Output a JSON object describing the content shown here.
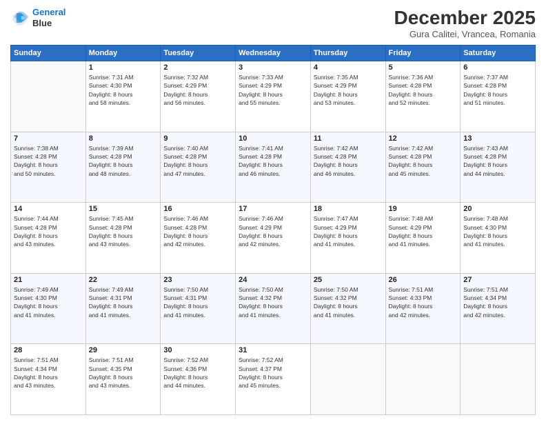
{
  "header": {
    "logo_line1": "General",
    "logo_line2": "Blue",
    "month": "December 2025",
    "location": "Gura Calitei, Vrancea, Romania"
  },
  "weekdays": [
    "Sunday",
    "Monday",
    "Tuesday",
    "Wednesday",
    "Thursday",
    "Friday",
    "Saturday"
  ],
  "weeks": [
    [
      {
        "day": "",
        "info": ""
      },
      {
        "day": "1",
        "info": "Sunrise: 7:31 AM\nSunset: 4:30 PM\nDaylight: 8 hours\nand 58 minutes."
      },
      {
        "day": "2",
        "info": "Sunrise: 7:32 AM\nSunset: 4:29 PM\nDaylight: 8 hours\nand 56 minutes."
      },
      {
        "day": "3",
        "info": "Sunrise: 7:33 AM\nSunset: 4:29 PM\nDaylight: 8 hours\nand 55 minutes."
      },
      {
        "day": "4",
        "info": "Sunrise: 7:35 AM\nSunset: 4:29 PM\nDaylight: 8 hours\nand 53 minutes."
      },
      {
        "day": "5",
        "info": "Sunrise: 7:36 AM\nSunset: 4:28 PM\nDaylight: 8 hours\nand 52 minutes."
      },
      {
        "day": "6",
        "info": "Sunrise: 7:37 AM\nSunset: 4:28 PM\nDaylight: 8 hours\nand 51 minutes."
      }
    ],
    [
      {
        "day": "7",
        "info": "Sunrise: 7:38 AM\nSunset: 4:28 PM\nDaylight: 8 hours\nand 50 minutes."
      },
      {
        "day": "8",
        "info": "Sunrise: 7:39 AM\nSunset: 4:28 PM\nDaylight: 8 hours\nand 48 minutes."
      },
      {
        "day": "9",
        "info": "Sunrise: 7:40 AM\nSunset: 4:28 PM\nDaylight: 8 hours\nand 47 minutes."
      },
      {
        "day": "10",
        "info": "Sunrise: 7:41 AM\nSunset: 4:28 PM\nDaylight: 8 hours\nand 46 minutes."
      },
      {
        "day": "11",
        "info": "Sunrise: 7:42 AM\nSunset: 4:28 PM\nDaylight: 8 hours\nand 46 minutes."
      },
      {
        "day": "12",
        "info": "Sunrise: 7:42 AM\nSunset: 4:28 PM\nDaylight: 8 hours\nand 45 minutes."
      },
      {
        "day": "13",
        "info": "Sunrise: 7:43 AM\nSunset: 4:28 PM\nDaylight: 8 hours\nand 44 minutes."
      }
    ],
    [
      {
        "day": "14",
        "info": "Sunrise: 7:44 AM\nSunset: 4:28 PM\nDaylight: 8 hours\nand 43 minutes."
      },
      {
        "day": "15",
        "info": "Sunrise: 7:45 AM\nSunset: 4:28 PM\nDaylight: 8 hours\nand 43 minutes."
      },
      {
        "day": "16",
        "info": "Sunrise: 7:46 AM\nSunset: 4:28 PM\nDaylight: 8 hours\nand 42 minutes."
      },
      {
        "day": "17",
        "info": "Sunrise: 7:46 AM\nSunset: 4:29 PM\nDaylight: 8 hours\nand 42 minutes."
      },
      {
        "day": "18",
        "info": "Sunrise: 7:47 AM\nSunset: 4:29 PM\nDaylight: 8 hours\nand 41 minutes."
      },
      {
        "day": "19",
        "info": "Sunrise: 7:48 AM\nSunset: 4:29 PM\nDaylight: 8 hours\nand 41 minutes."
      },
      {
        "day": "20",
        "info": "Sunrise: 7:48 AM\nSunset: 4:30 PM\nDaylight: 8 hours\nand 41 minutes."
      }
    ],
    [
      {
        "day": "21",
        "info": "Sunrise: 7:49 AM\nSunset: 4:30 PM\nDaylight: 8 hours\nand 41 minutes."
      },
      {
        "day": "22",
        "info": "Sunrise: 7:49 AM\nSunset: 4:31 PM\nDaylight: 8 hours\nand 41 minutes."
      },
      {
        "day": "23",
        "info": "Sunrise: 7:50 AM\nSunset: 4:31 PM\nDaylight: 8 hours\nand 41 minutes."
      },
      {
        "day": "24",
        "info": "Sunrise: 7:50 AM\nSunset: 4:32 PM\nDaylight: 8 hours\nand 41 minutes."
      },
      {
        "day": "25",
        "info": "Sunrise: 7:50 AM\nSunset: 4:32 PM\nDaylight: 8 hours\nand 41 minutes."
      },
      {
        "day": "26",
        "info": "Sunrise: 7:51 AM\nSunset: 4:33 PM\nDaylight: 8 hours\nand 42 minutes."
      },
      {
        "day": "27",
        "info": "Sunrise: 7:51 AM\nSunset: 4:34 PM\nDaylight: 8 hours\nand 42 minutes."
      }
    ],
    [
      {
        "day": "28",
        "info": "Sunrise: 7:51 AM\nSunset: 4:34 PM\nDaylight: 8 hours\nand 43 minutes."
      },
      {
        "day": "29",
        "info": "Sunrise: 7:51 AM\nSunset: 4:35 PM\nDaylight: 8 hours\nand 43 minutes."
      },
      {
        "day": "30",
        "info": "Sunrise: 7:52 AM\nSunset: 4:36 PM\nDaylight: 8 hours\nand 44 minutes."
      },
      {
        "day": "31",
        "info": "Sunrise: 7:52 AM\nSunset: 4:37 PM\nDaylight: 8 hours\nand 45 minutes."
      },
      {
        "day": "",
        "info": ""
      },
      {
        "day": "",
        "info": ""
      },
      {
        "day": "",
        "info": ""
      }
    ]
  ]
}
